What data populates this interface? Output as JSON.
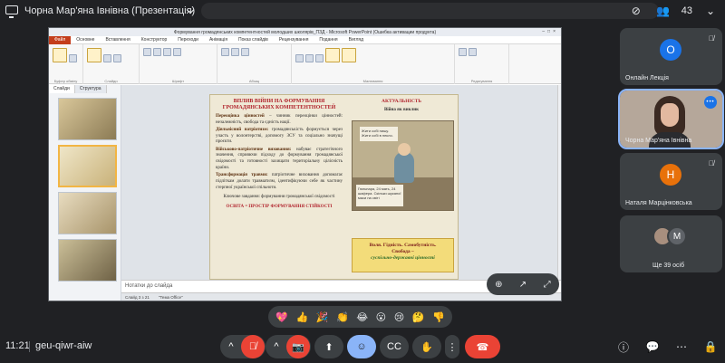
{
  "meeting": {
    "presenter_title": "Чорна Мар'яна Івнівна (Презентація)",
    "participant_count": "43",
    "time": "11:21",
    "code": "geu-qiwr-aiw"
  },
  "ppt": {
    "window_title": "Формування громадянських компетентностей молодших школярів_ПЗД - Microsoft PowerPoint (Ошибка активации продукта)",
    "tabs": [
      "Файл",
      "Основне",
      "Вставлення",
      "Конструктор",
      "Переходи",
      "Анімація",
      "Показ слайдів",
      "Рецензування",
      "Подання",
      "Вигляд"
    ],
    "ribbon_groups": [
      "Буфер обміну",
      "Слайди",
      "Шрифт",
      "Абзац",
      "Малювання",
      "Редагування"
    ],
    "thumb_tabs": [
      "Слайди",
      "Структура"
    ],
    "notes_placeholder": "Нотатки до слайда",
    "status": [
      "Слайд 3 з 21",
      "\"Тема Office\""
    ]
  },
  "slide": {
    "title": "ВПЛИВ ВІЙНИ НА ФОРМУВАННЯ ГРОМАДЯНСЬКИХ КОМПЕТЕНТНОСТЕЙ",
    "p1_term": "Переоцінка цінностей",
    "p1_text": " – чинник переоцінки цінностей: незалежність, свобода та єдність нації.",
    "p2_term": "Діяльнісний патріотизм:",
    "p2_text": " громадянськість формується через участь у волонтерстві, допомогу ЗСУ та соціально значущі проєкти.",
    "p3_term": "Військово-патріотичне виховання:",
    "p3_text": " набуває стратегічного значення, сприяючи підходу до формування громадянської свідомості та готовності захищати територіальну цілісність країни.",
    "p4_term": "Трансформація травми:",
    "p4_text": " патріотичне виховання допомагає підліткам долати травматизм, ідентифікуючи себе як частину стерпної української спільноти.",
    "key": "Ключове завдання: формування громадянської свідомості",
    "osvita": "ОСВІТА = ПРОСТІР ФОРМУВАННЯ СТІЙКОСТІ",
    "actuality": "АКТУАЛЬНІСТЬ",
    "war_eyes": "Війна як виклик",
    "note1": "Жити собі пишу. Жити собі в пекло.",
    "note2": "Гюльнара, 24 мать, 24 шафера. Скільки шуканої маси на світі",
    "box_line1": "Воля. Гідність. Самобутність.",
    "box_line2": "Свобода –",
    "box_line3": "суспільно-державні цінності"
  },
  "tiles": [
    {
      "name": "Онлайн Лекція",
      "initial": "О",
      "color": "#1a73e8"
    },
    {
      "name": "Чорна Мар'яна Івнівна"
    },
    {
      "name": "Наталя Марцінковська",
      "initial": "Н",
      "color": "#e8710a"
    },
    {
      "name": "Ще 39 осіб",
      "initial2": "M"
    }
  ],
  "reactions": [
    "💖",
    "👍",
    "🎉",
    "👏",
    "😂",
    "😮",
    "😢",
    "🤔",
    "👎"
  ],
  "colors": {
    "end_call": "#ea4335",
    "accent": "#8ab4f8",
    "tile_bg": "#3c4043"
  }
}
